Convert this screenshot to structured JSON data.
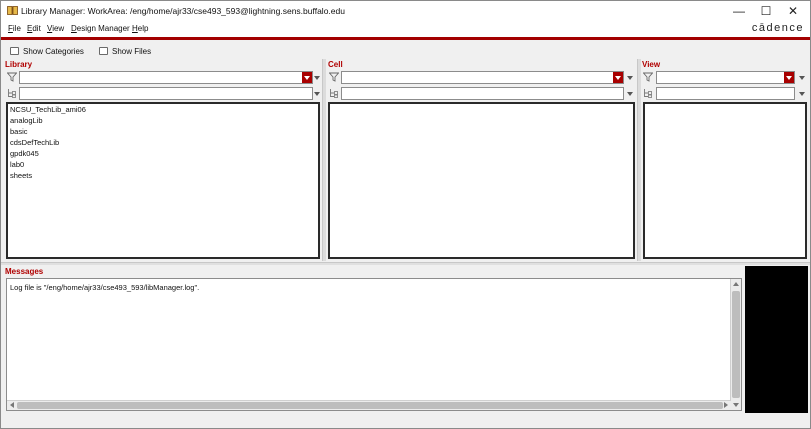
{
  "window": {
    "title": "Library Manager: WorkArea:  /eng/home/ajr33/cse493_593@lightning.sens.buffalo.edu",
    "minimize_glyph": "—",
    "maximize_glyph": "☐",
    "close_glyph": "✕",
    "brand": "cādence"
  },
  "menu": {
    "items": [
      {
        "accel": "F",
        "rest": "ile"
      },
      {
        "accel": "E",
        "rest": "dit"
      },
      {
        "accel": "V",
        "rest": "iew"
      },
      {
        "accel": "D",
        "rest": "esign Manager"
      },
      {
        "accel": "H",
        "rest": "elp"
      }
    ]
  },
  "toolbar": {
    "show_categories": {
      "label": "Show Categories",
      "checked": false
    },
    "show_files": {
      "label": "Show Files",
      "checked": false
    }
  },
  "panes": {
    "library": {
      "title": "Library",
      "filter_value": "",
      "category_value": "",
      "items": [
        "NCSU_TechLib_ami06",
        "analogLib",
        "basic",
        "cdsDefTechLib",
        "gpdk045",
        "lab0",
        "sheets"
      ]
    },
    "cell": {
      "title": "Cell",
      "filter_value": "",
      "category_value": "",
      "items": []
    },
    "view": {
      "title": "View",
      "filter_value": "",
      "category_value": "",
      "items": []
    }
  },
  "messages": {
    "title": "Messages",
    "text": "Log file is \"/eng/home/ajr33/cse493_593/libManager.log\"."
  },
  "colors": {
    "accent_red": "#a80000",
    "panel_black": "#000000"
  },
  "icons": {
    "app": "book-icon",
    "filter": "filter-icon",
    "category": "category-tree-icon"
  }
}
